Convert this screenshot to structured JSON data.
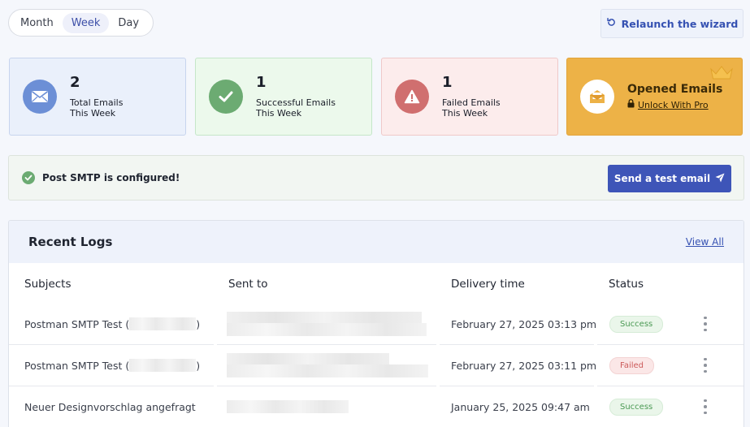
{
  "period": {
    "options": [
      "Month",
      "Week",
      "Day"
    ],
    "selected": "Week"
  },
  "relaunch_label": "Relaunch the wizard",
  "stats": [
    {
      "number": "2",
      "label": "Total Emails",
      "sub": "This Week",
      "icon": "envelope-icon",
      "color": "#6c8fd6"
    },
    {
      "number": "1",
      "label": "Successful Emails",
      "sub": "This Week",
      "icon": "check-icon",
      "color": "#6cab72"
    },
    {
      "number": "1",
      "label": "Failed Emails",
      "sub": "This Week",
      "icon": "warning-icon",
      "color": "#d06f6f"
    }
  ],
  "opened": {
    "title": "Opened Emails",
    "unlock_label": "Unlock With Pro",
    "icon": "open-envelope-icon"
  },
  "config": {
    "message": "Post SMTP is configured!",
    "send_button": "Send a test email"
  },
  "logs": {
    "title": "Recent Logs",
    "view_all": "View All",
    "columns": [
      "Subjects",
      "Sent to",
      "Delivery time",
      "Status"
    ],
    "rows": [
      {
        "subject_prefix": "Postman SMTP Test (",
        "subject_suffix": ")",
        "delivery_time": "February 27, 2025 03:13 pm",
        "status": "Success"
      },
      {
        "subject_prefix": "Postman SMTP Test (",
        "subject_suffix": ")",
        "delivery_time": "February 27, 2025 03:11 pm",
        "status": "Failed"
      },
      {
        "subject_prefix": "Neuer Designvorschlag angefragt",
        "subject_suffix": "",
        "delivery_time": "January 25, 2025 09:47 am",
        "status": "Success"
      }
    ]
  },
  "colors": {
    "accent": "#3e55b8",
    "success": "#4b9a54",
    "failed": "#cc5a5a",
    "pro": "#edb247"
  }
}
